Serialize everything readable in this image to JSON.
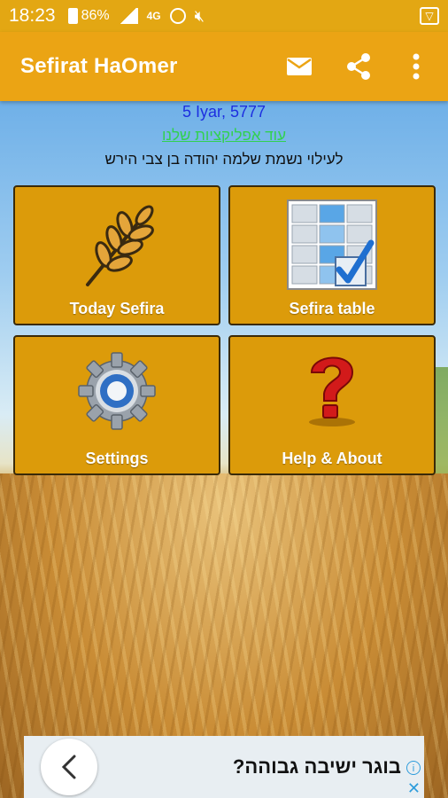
{
  "status_bar": {
    "time": "18:23",
    "battery": "86%",
    "network": "4G"
  },
  "app_bar": {
    "title": "Sefirat HaOmer",
    "actions": [
      "mail-icon",
      "share-icon",
      "more-vert-icon"
    ]
  },
  "header": {
    "date": "5 Iyar, 5777",
    "apps_link": "עוד אפליקציות שלנו",
    "dedication": "לעילוי נשמת שלמה יהודה בן צבי הירש"
  },
  "tiles": [
    {
      "label": "Today Sefira",
      "icon": "wheat-icon"
    },
    {
      "label": "Sefira table",
      "icon": "table-check-icon"
    },
    {
      "label": "Settings",
      "icon": "gear-icon"
    },
    {
      "label": "Help & About",
      "icon": "question-icon"
    }
  ],
  "ad": {
    "text": "בוגר ישיבה גבוהה?"
  },
  "colors": {
    "app_bar": "#eba414",
    "tile": "#dc9b0a",
    "date_text": "#1d2fe0",
    "link_text": "#31d14f"
  }
}
